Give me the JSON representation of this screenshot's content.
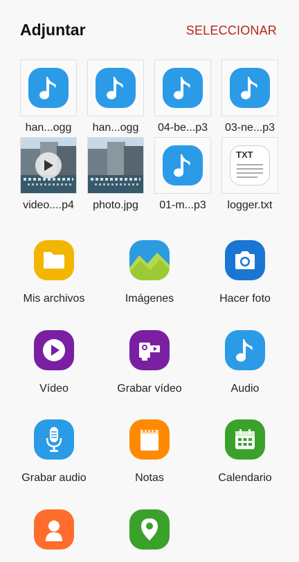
{
  "header": {
    "title": "Adjuntar",
    "select_label": "SELECCIONAR"
  },
  "colors": {
    "accent": "#b3261e",
    "music_blue": "#2b9be8"
  },
  "recent_files": [
    {
      "label": "han...ogg",
      "type": "audio",
      "icon": "music-note-icon"
    },
    {
      "label": "han...ogg",
      "type": "audio",
      "icon": "music-note-icon"
    },
    {
      "label": "04-be...p3",
      "type": "audio",
      "icon": "music-note-icon"
    },
    {
      "label": "03-ne...p3",
      "type": "audio",
      "icon": "music-note-icon"
    },
    {
      "label": "video....p4",
      "type": "video",
      "icon": "play-icon"
    },
    {
      "label": "photo.jpg",
      "type": "image",
      "icon": "photo-thumbnail"
    },
    {
      "label": "01-m...p3",
      "type": "audio",
      "icon": "music-note-icon"
    },
    {
      "label": "logger.txt",
      "type": "text",
      "icon": "txt-file-icon",
      "icon_text": "TXT"
    }
  ],
  "apps": [
    {
      "label": "Mis archivos",
      "icon": "folder-icon",
      "color": "#f2b600"
    },
    {
      "label": "Imágenes",
      "icon": "gallery-icon",
      "color": "#2d9be0"
    },
    {
      "label": "Hacer foto",
      "icon": "camera-icon",
      "color": "#1976d2"
    },
    {
      "label": "Vídeo",
      "icon": "video-play-icon",
      "color": "#7b1fa2"
    },
    {
      "label": "Grabar vídeo",
      "icon": "video-recorder-icon",
      "color": "#7b1fa2"
    },
    {
      "label": "Audio",
      "icon": "music-note-icon",
      "color": "#2b9be8"
    },
    {
      "label": "Grabar audio",
      "icon": "microphone-icon",
      "color": "#2b9be8"
    },
    {
      "label": "Notas",
      "icon": "notepad-icon",
      "color": "#ff8a00"
    },
    {
      "label": "Calendario",
      "icon": "calendar-icon",
      "color": "#3aa12b"
    },
    {
      "label": "",
      "icon": "contact-icon",
      "color": "#ff6d2d"
    },
    {
      "label": "",
      "icon": "location-icon",
      "color": "#3aa12b"
    }
  ]
}
